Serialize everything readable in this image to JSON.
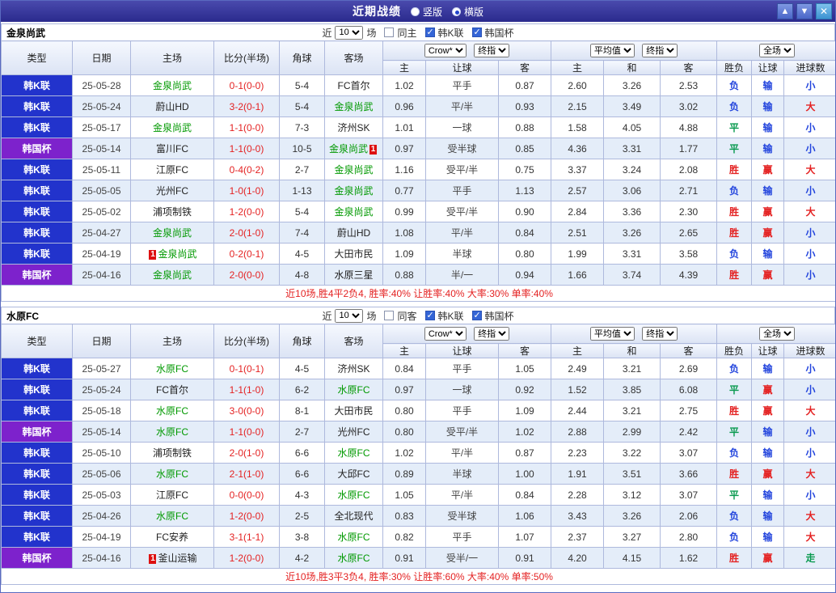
{
  "title_bar": {
    "title": "近期战绩",
    "layout_options": [
      {
        "label": "竖版",
        "selected": false
      },
      {
        "label": "横版",
        "selected": true
      }
    ],
    "buttons": {
      "up": "▲",
      "down": "▼",
      "close": "✕"
    }
  },
  "colors": {
    "league_blue": "#2233cc",
    "cup_purple": "#7d22cc",
    "team_highlight_green": "#009900",
    "win_red": "#e42222",
    "lose_blue": "#2244dd",
    "draw_green": "#0a9a50",
    "titlebar_blue": "#32329b"
  },
  "columns": {
    "type": "类型",
    "date": "日期",
    "home": "主场",
    "score": "比分(半场)",
    "corners": "角球",
    "away": "客场",
    "odds_select": "Crow*",
    "final_select": "终指",
    "odds_sub": [
      "主",
      "让球",
      "客"
    ],
    "avg_select": "平均值",
    "avg_sub": [
      "主",
      "和",
      "客"
    ],
    "full_select": "全场",
    "result_sub": [
      "胜负",
      "让球",
      "进球数"
    ]
  },
  "tables": [
    {
      "team": "金泉尚武",
      "controls": {
        "near": "近",
        "count": "10",
        "games": "场",
        "same": "同主",
        "same_checked": false,
        "league1": "韩K联",
        "league1_checked": true,
        "league2": "韩国杯",
        "league2_checked": true
      },
      "rows": [
        {
          "type": "韩K联",
          "date": "25-05-28",
          "home": {
            "name": "金泉尚武",
            "hl": true
          },
          "score": "0-1(0-0)",
          "corners": "5-4",
          "away": {
            "name": "FC首尔"
          },
          "odds": [
            "1.02",
            "平手",
            "0.87"
          ],
          "avg": [
            "2.60",
            "3.26",
            "2.53"
          ],
          "results": [
            "负",
            "输",
            "小"
          ]
        },
        {
          "type": "韩K联",
          "date": "25-05-24",
          "home": {
            "name": "蔚山HD"
          },
          "score": "3-2(0-1)",
          "corners": "5-4",
          "away": {
            "name": "金泉尚武",
            "hl": true
          },
          "odds": [
            "0.96",
            "平/半",
            "0.93"
          ],
          "avg": [
            "2.15",
            "3.49",
            "3.02"
          ],
          "results": [
            "负",
            "输",
            "大"
          ]
        },
        {
          "type": "韩K联",
          "date": "25-05-17",
          "home": {
            "name": "金泉尚武",
            "hl": true
          },
          "score": "1-1(0-0)",
          "corners": "7-3",
          "away": {
            "name": "济州SK"
          },
          "odds": [
            "1.01",
            "一球",
            "0.88"
          ],
          "avg": [
            "1.58",
            "4.05",
            "4.88"
          ],
          "results": [
            "平",
            "输",
            "小"
          ]
        },
        {
          "type": "韩国杯",
          "date": "25-05-14",
          "home": {
            "name": "富川FC"
          },
          "score": "1-1(0-0)",
          "corners": "10-5",
          "away": {
            "name": "金泉尚武",
            "hl": true,
            "card": "1",
            "card_pos": "after"
          },
          "odds": [
            "0.97",
            "受半球",
            "0.85"
          ],
          "avg": [
            "4.36",
            "3.31",
            "1.77"
          ],
          "results": [
            "平",
            "输",
            "小"
          ]
        },
        {
          "type": "韩K联",
          "date": "25-05-11",
          "home": {
            "name": "江原FC"
          },
          "score": "0-4(0-2)",
          "corners": "2-7",
          "away": {
            "name": "金泉尚武",
            "hl": true
          },
          "odds": [
            "1.16",
            "受平/半",
            "0.75"
          ],
          "avg": [
            "3.37",
            "3.24",
            "2.08"
          ],
          "results": [
            "胜",
            "赢",
            "大"
          ]
        },
        {
          "type": "韩K联",
          "date": "25-05-05",
          "home": {
            "name": "光州FC"
          },
          "score": "1-0(1-0)",
          "corners": "1-13",
          "away": {
            "name": "金泉尚武",
            "hl": true
          },
          "odds": [
            "0.77",
            "平手",
            "1.13"
          ],
          "avg": [
            "2.57",
            "3.06",
            "2.71"
          ],
          "results": [
            "负",
            "输",
            "小"
          ]
        },
        {
          "type": "韩K联",
          "date": "25-05-02",
          "home": {
            "name": "浦项制铁"
          },
          "score": "1-2(0-0)",
          "corners": "5-4",
          "away": {
            "name": "金泉尚武",
            "hl": true
          },
          "odds": [
            "0.99",
            "受平/半",
            "0.90"
          ],
          "avg": [
            "2.84",
            "3.36",
            "2.30"
          ],
          "results": [
            "胜",
            "赢",
            "大"
          ]
        },
        {
          "type": "韩K联",
          "date": "25-04-27",
          "home": {
            "name": "金泉尚武",
            "hl": true
          },
          "score": "2-0(1-0)",
          "corners": "7-4",
          "away": {
            "name": "蔚山HD"
          },
          "odds": [
            "1.08",
            "平/半",
            "0.84"
          ],
          "avg": [
            "2.51",
            "3.26",
            "2.65"
          ],
          "results": [
            "胜",
            "赢",
            "小"
          ]
        },
        {
          "type": "韩K联",
          "date": "25-04-19",
          "home": {
            "name": "金泉尚武",
            "hl": true,
            "card": "1",
            "card_pos": "before"
          },
          "score": "0-2(0-1)",
          "corners": "4-5",
          "away": {
            "name": "大田市民"
          },
          "odds": [
            "1.09",
            "半球",
            "0.80"
          ],
          "avg": [
            "1.99",
            "3.31",
            "3.58"
          ],
          "results": [
            "负",
            "输",
            "小"
          ]
        },
        {
          "type": "韩国杯",
          "date": "25-04-16",
          "home": {
            "name": "金泉尚武",
            "hl": true
          },
          "score": "2-0(0-0)",
          "corners": "4-8",
          "away": {
            "name": "水原三星"
          },
          "odds": [
            "0.88",
            "半/一",
            "0.94"
          ],
          "avg": [
            "1.66",
            "3.74",
            "4.39"
          ],
          "results": [
            "胜",
            "赢",
            "小"
          ]
        }
      ],
      "footer": "近10场,胜4平2负4, 胜率:40% 让胜率:40% 大率:30% 单率:40%"
    },
    {
      "team": "水原FC",
      "controls": {
        "near": "近",
        "count": "10",
        "games": "场",
        "same": "同客",
        "same_checked": false,
        "league1": "韩K联",
        "league1_checked": true,
        "league2": "韩国杯",
        "league2_checked": true
      },
      "rows": [
        {
          "type": "韩K联",
          "date": "25-05-27",
          "home": {
            "name": "水原FC",
            "hl": true
          },
          "score": "0-1(0-1)",
          "corners": "4-5",
          "away": {
            "name": "济州SK"
          },
          "odds": [
            "0.84",
            "平手",
            "1.05"
          ],
          "avg": [
            "2.49",
            "3.21",
            "2.69"
          ],
          "results": [
            "负",
            "输",
            "小"
          ]
        },
        {
          "type": "韩K联",
          "date": "25-05-24",
          "home": {
            "name": "FC首尔"
          },
          "score": "1-1(1-0)",
          "corners": "6-2",
          "away": {
            "name": "水原FC",
            "hl": true
          },
          "odds": [
            "0.97",
            "一球",
            "0.92"
          ],
          "avg": [
            "1.52",
            "3.85",
            "6.08"
          ],
          "results": [
            "平",
            "赢",
            "小"
          ]
        },
        {
          "type": "韩K联",
          "date": "25-05-18",
          "home": {
            "name": "水原FC",
            "hl": true
          },
          "score": "3-0(0-0)",
          "corners": "8-1",
          "away": {
            "name": "大田市民"
          },
          "odds": [
            "0.80",
            "平手",
            "1.09"
          ],
          "avg": [
            "2.44",
            "3.21",
            "2.75"
          ],
          "results": [
            "胜",
            "赢",
            "大"
          ]
        },
        {
          "type": "韩国杯",
          "date": "25-05-14",
          "home": {
            "name": "水原FC",
            "hl": true
          },
          "score": "1-1(0-0)",
          "corners": "2-7",
          "away": {
            "name": "光州FC"
          },
          "odds": [
            "0.80",
            "受平/半",
            "1.02"
          ],
          "avg": [
            "2.88",
            "2.99",
            "2.42"
          ],
          "results": [
            "平",
            "输",
            "小"
          ]
        },
        {
          "type": "韩K联",
          "date": "25-05-10",
          "home": {
            "name": "浦项制铁"
          },
          "score": "2-0(1-0)",
          "corners": "6-6",
          "away": {
            "name": "水原FC",
            "hl": true
          },
          "odds": [
            "1.02",
            "平/半",
            "0.87"
          ],
          "avg": [
            "2.23",
            "3.22",
            "3.07"
          ],
          "results": [
            "负",
            "输",
            "小"
          ]
        },
        {
          "type": "韩K联",
          "date": "25-05-06",
          "home": {
            "name": "水原FC",
            "hl": true
          },
          "score": "2-1(1-0)",
          "corners": "6-6",
          "away": {
            "name": "大邱FC"
          },
          "odds": [
            "0.89",
            "半球",
            "1.00"
          ],
          "avg": [
            "1.91",
            "3.51",
            "3.66"
          ],
          "results": [
            "胜",
            "赢",
            "大"
          ]
        },
        {
          "type": "韩K联",
          "date": "25-05-03",
          "home": {
            "name": "江原FC"
          },
          "score": "0-0(0-0)",
          "corners": "4-3",
          "away": {
            "name": "水原FC",
            "hl": true
          },
          "odds": [
            "1.05",
            "平/半",
            "0.84"
          ],
          "avg": [
            "2.28",
            "3.12",
            "3.07"
          ],
          "results": [
            "平",
            "输",
            "小"
          ]
        },
        {
          "type": "韩K联",
          "date": "25-04-26",
          "home": {
            "name": "水原FC",
            "hl": true
          },
          "score": "1-2(0-0)",
          "corners": "2-5",
          "away": {
            "name": "全北现代"
          },
          "odds": [
            "0.83",
            "受半球",
            "1.06"
          ],
          "avg": [
            "3.43",
            "3.26",
            "2.06"
          ],
          "results": [
            "负",
            "输",
            "大"
          ]
        },
        {
          "type": "韩K联",
          "date": "25-04-19",
          "home": {
            "name": "FC安养"
          },
          "score": "3-1(1-1)",
          "corners": "3-8",
          "away": {
            "name": "水原FC",
            "hl": true
          },
          "odds": [
            "0.82",
            "平手",
            "1.07"
          ],
          "avg": [
            "2.37",
            "3.27",
            "2.80"
          ],
          "results": [
            "负",
            "输",
            "大"
          ]
        },
        {
          "type": "韩国杯",
          "date": "25-04-16",
          "home": {
            "name": "釜山运输",
            "card": "1",
            "card_pos": "before"
          },
          "score": "1-2(0-0)",
          "corners": "4-2",
          "away": {
            "name": "水原FC",
            "hl": true
          },
          "odds": [
            "0.91",
            "受半/一",
            "0.91"
          ],
          "avg": [
            "4.20",
            "4.15",
            "1.62"
          ],
          "results": [
            "胜",
            "赢",
            "走"
          ]
        }
      ],
      "footer": "近10场,胜3平3负4, 胜率:30% 让胜率:60% 大率:40% 单率:50%"
    }
  ]
}
